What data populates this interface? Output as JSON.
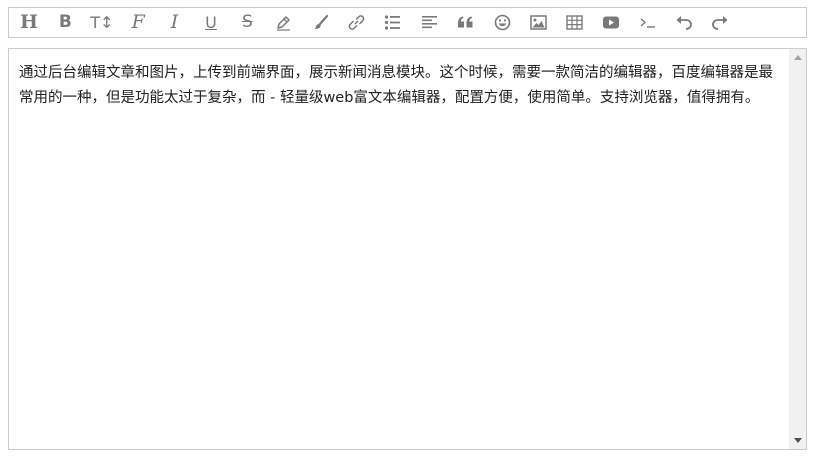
{
  "toolbar": {
    "icon_color": "#7a7a7a",
    "tools": [
      {
        "name": "header-icon",
        "glyph": "H"
      },
      {
        "name": "bold-icon",
        "glyph": "B"
      },
      {
        "name": "font-size-icon",
        "glyph": "T↕"
      },
      {
        "name": "font-family-icon",
        "glyph": "F"
      },
      {
        "name": "italic-icon",
        "glyph": "I"
      },
      {
        "name": "underline-icon",
        "glyph": "U"
      },
      {
        "name": "strikethrough-icon",
        "glyph": "S"
      },
      {
        "name": "text-color-icon",
        "glyph": "pencil"
      },
      {
        "name": "background-color-icon",
        "glyph": "brush"
      },
      {
        "name": "link-icon",
        "glyph": "link"
      },
      {
        "name": "list-icon",
        "glyph": "list"
      },
      {
        "name": "align-icon",
        "glyph": "align"
      },
      {
        "name": "quote-icon",
        "glyph": "quote"
      },
      {
        "name": "emoticon-icon",
        "glyph": "smile"
      },
      {
        "name": "image-icon",
        "glyph": "image"
      },
      {
        "name": "table-icon",
        "glyph": "table"
      },
      {
        "name": "video-icon",
        "glyph": "video"
      },
      {
        "name": "code-icon",
        "glyph": "code"
      },
      {
        "name": "undo-icon",
        "glyph": "undo"
      },
      {
        "name": "redo-icon",
        "glyph": "redo"
      }
    ]
  },
  "editor": {
    "content": " 通过后台编辑文章和图片，上传到前端界面，展示新闻消息模块。这个时候，需要一款简洁的编辑器，百度编辑器是最常用的一种，但是功能太过于复杂，而 - 轻量级web富文本编辑器，配置方便，使用简单。支持浏览器，值得拥有。"
  }
}
